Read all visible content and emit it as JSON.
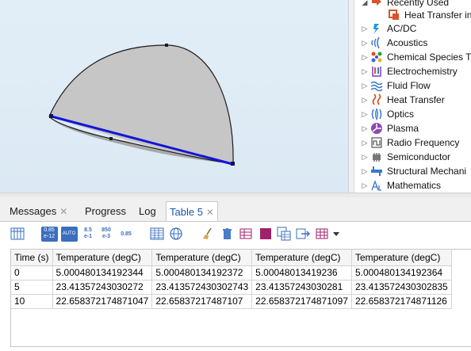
{
  "physics_list": {
    "items": [
      {
        "label": "Recently Used",
        "icon": "recently-used-icon",
        "expanded": true
      },
      {
        "label": "Heat Transfer in",
        "icon": "heat-transfer-solids-icon",
        "child": true
      },
      {
        "label": "AC/DC",
        "icon": "acdc-icon"
      },
      {
        "label": "Acoustics",
        "icon": "acoustics-icon"
      },
      {
        "label": "Chemical Species T",
        "icon": "chemical-species-icon"
      },
      {
        "label": "Electrochemistry",
        "icon": "electrochemistry-icon"
      },
      {
        "label": "Fluid Flow",
        "icon": "fluid-flow-icon"
      },
      {
        "label": "Heat Transfer",
        "icon": "heat-transfer-icon"
      },
      {
        "label": "Optics",
        "icon": "optics-icon"
      },
      {
        "label": "Plasma",
        "icon": "plasma-icon"
      },
      {
        "label": "Radio Frequency",
        "icon": "radio-frequency-icon"
      },
      {
        "label": "Semiconductor",
        "icon": "semiconductor-icon"
      },
      {
        "label": "Structural Mechani",
        "icon": "structural-mechanics-icon"
      },
      {
        "label": "Mathematics",
        "icon": "mathematics-icon"
      }
    ]
  },
  "tabs": [
    {
      "label": "Messages",
      "close": "✕",
      "active": false
    },
    {
      "label": "Progress",
      "active": false
    },
    {
      "label": "Log",
      "active": false
    },
    {
      "label": "Table 5",
      "close": "✕",
      "active": true
    }
  ],
  "toolbar": {
    "icons": [
      "table-layout-icon",
      "full-precision-icon",
      "auto-precision-icon",
      "manual-precision-icon",
      "engineering-notation-icon",
      "decimal-format-icon",
      "table-grid-icon",
      "web-icon",
      "clear-brush-icon",
      "delete-icon",
      "table-settings-icon",
      "color-square-icon",
      "copy-table-icon",
      "export-icon",
      "table-menu-icon",
      "dropdown-arrow-icon"
    ],
    "labels": {
      "full_precision": [
        "0.85",
        "e-12"
      ],
      "auto_precision": "AUTO",
      "manual_precision": [
        "8.5",
        "e-1"
      ],
      "engineering": [
        "850",
        "e-3"
      ],
      "decimal": "0.85"
    }
  },
  "table": {
    "headers": [
      "Time (s)",
      "Temperature (degC)",
      "Temperature (degC)",
      "Temperature (degC)",
      "Temperature (degC)"
    ],
    "rows": [
      [
        "0",
        "5.000480134192344",
        "5.000480134192372",
        "5.00048013419236",
        "5.000480134192364"
      ],
      [
        "5",
        "23.41357243030272",
        "23.413572430302743",
        "23.41357243030281",
        "23.413572430302835"
      ],
      [
        "10",
        "22.658372174871047",
        "22.65837217487107",
        "22.658372174871097",
        "22.658372174871126"
      ]
    ]
  },
  "colors": {
    "edge_highlight": "#1414d8",
    "geometry_fill": "#c8c8c8",
    "accent_tab": "#1a56a8"
  }
}
